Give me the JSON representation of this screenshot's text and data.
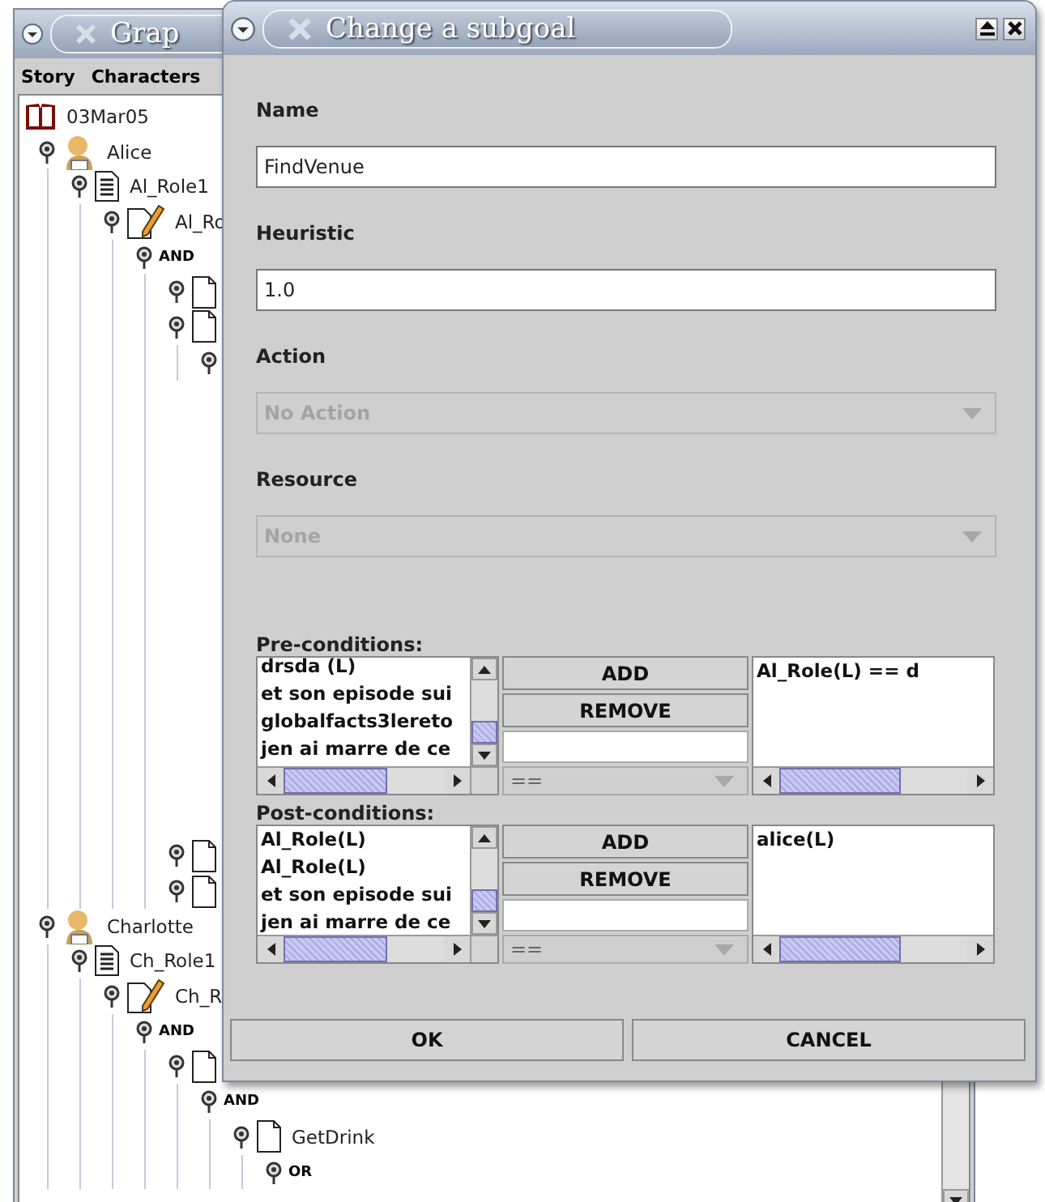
{
  "background_window": {
    "title": "Grap",
    "menu": [
      "Story",
      "Characters"
    ],
    "tree": {
      "kind": "book",
      "label": "03Mar05",
      "children": [
        {
          "kind": "person",
          "label": "Alice",
          "children": [
            {
              "kind": "document",
              "label": "Al_Role1",
              "children": [
                {
                  "kind": "script",
                  "label": "Al_Ro",
                  "children": [
                    {
                      "kind": "operator",
                      "label": "AND",
                      "children": [
                        {
                          "kind": "page"
                        },
                        {
                          "kind": "page",
                          "children": [
                            {
                              "kind": "connector"
                            }
                          ]
                        },
                        {
                          "kind": "page"
                        },
                        {
                          "kind": "page"
                        }
                      ]
                    }
                  ]
                }
              ]
            }
          ]
        },
        {
          "kind": "person",
          "label": "Charlotte",
          "children": [
            {
              "kind": "document",
              "label": "Ch_Role1",
              "children": [
                {
                  "kind": "script",
                  "label": "Ch_R",
                  "children": [
                    {
                      "kind": "operator",
                      "label": "AND",
                      "children": [
                        {
                          "kind": "page",
                          "children": [
                            {
                              "kind": "operator",
                              "label": "AND",
                              "children": [
                                {
                                  "kind": "page",
                                  "label": "GetDrink",
                                  "children": [
                                    {
                                      "kind": "operator",
                                      "label": "OR"
                                    }
                                  ]
                                }
                              ]
                            }
                          ]
                        }
                      ]
                    }
                  ]
                }
              ]
            }
          ]
        }
      ]
    }
  },
  "dialog": {
    "title": "Change a subgoal",
    "fields": [
      {
        "kind": "text",
        "label": "Name",
        "value": "FindVenue",
        "disabled": false
      },
      {
        "kind": "text",
        "label": "Heuristic",
        "value": "1.0",
        "disabled": false
      },
      {
        "kind": "combo",
        "label": "Action",
        "value": "No Action",
        "disabled": true
      },
      {
        "kind": "combo",
        "label": "Resource",
        "value": "None",
        "disabled": true
      }
    ],
    "condition_groups": [
      {
        "label": "Pre-conditions:",
        "available": [
          "drsda (L)",
          "et son episode sui",
          "globalfacts3lereto",
          "jen ai marre de ce"
        ],
        "add_button": "ADD",
        "remove_button": "REMOVE",
        "operator": {
          "value": "==",
          "disabled": true
        },
        "conditions": [
          "Al_Role(L) == d"
        ]
      },
      {
        "label": "Post-conditions:",
        "available": [
          "Al_Role(L)",
          "Al_Role(L)",
          "et son episode sui",
          "jen ai marre de ce"
        ],
        "add_button": "ADD",
        "remove_button": "REMOVE",
        "operator": {
          "value": "==",
          "disabled": true
        },
        "conditions": [
          "alice(L)"
        ]
      }
    ],
    "buttons": [
      "OK",
      "CANCEL"
    ]
  }
}
